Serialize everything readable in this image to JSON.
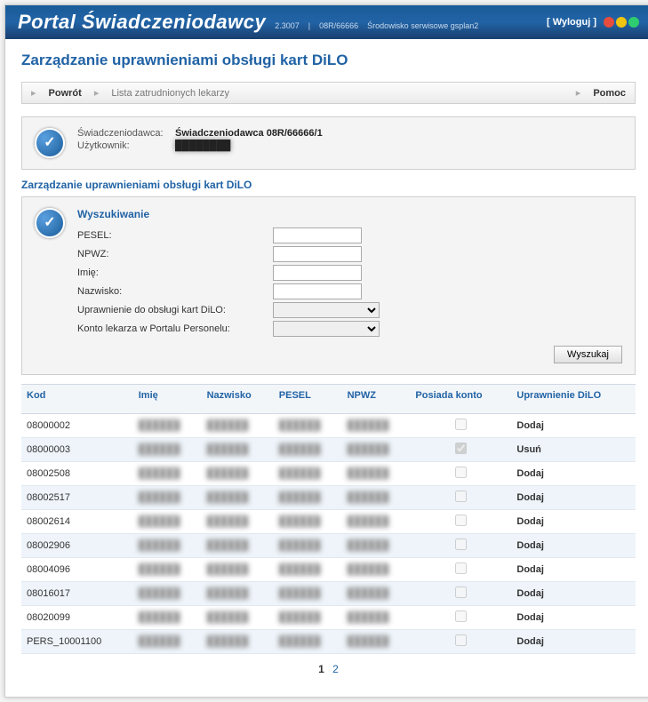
{
  "header": {
    "app_title": "Portal Świadczeniodawcy",
    "version": "2.3007",
    "account": "08R/66666",
    "env": "Środowisko serwisowe gsplan2",
    "logout": "[ Wyloguj ]"
  },
  "page": {
    "title": "Zarządzanie uprawnieniami obsługi kart DiLO"
  },
  "toolbar": {
    "back": "Powrót",
    "doctors": "Lista zatrudnionych lekarzy",
    "help": "Pomoc"
  },
  "info": {
    "provider_label": "Świadczeniodawca:",
    "provider_value": "Świadczeniodawca 08R/66666/1",
    "user_label": "Użytkownik:",
    "user_value": "████████"
  },
  "section_title": "Zarządzanie uprawnieniami obsługi kart DiLO",
  "search": {
    "title": "Wyszukiwanie",
    "pesel": "PESEL:",
    "npwz": "NPWZ:",
    "imie": "Imię:",
    "nazwisko": "Nazwisko:",
    "uprawnienie": "Uprawnienie do obsługi kart DiLO:",
    "konto": "Konto lekarza w Portalu Personelu:",
    "button": "Wyszukaj"
  },
  "table": {
    "headers": {
      "kod": "Kod",
      "imie": "Imię",
      "nazwisko": "Nazwisko",
      "pesel": "PESEL",
      "npwz": "NPWZ",
      "posiada": "Posiada konto",
      "upr": "Uprawnienie DiLO"
    },
    "rows": [
      {
        "kod": "08000002",
        "posiada": false,
        "action": "Dodaj"
      },
      {
        "kod": "08000003",
        "posiada": true,
        "action": "Usuń"
      },
      {
        "kod": "08002508",
        "posiada": false,
        "action": "Dodaj"
      },
      {
        "kod": "08002517",
        "posiada": false,
        "action": "Dodaj"
      },
      {
        "kod": "08002614",
        "posiada": false,
        "action": "Dodaj"
      },
      {
        "kod": "08002906",
        "posiada": false,
        "action": "Dodaj"
      },
      {
        "kod": "08004096",
        "posiada": false,
        "action": "Dodaj"
      },
      {
        "kod": "08016017",
        "posiada": false,
        "action": "Dodaj"
      },
      {
        "kod": "08020099",
        "posiada": false,
        "action": "Dodaj"
      },
      {
        "kod": "PERS_10001100",
        "posiada": false,
        "action": "Dodaj"
      }
    ]
  },
  "pager": {
    "pages": [
      "1",
      "2"
    ],
    "current": "1"
  }
}
